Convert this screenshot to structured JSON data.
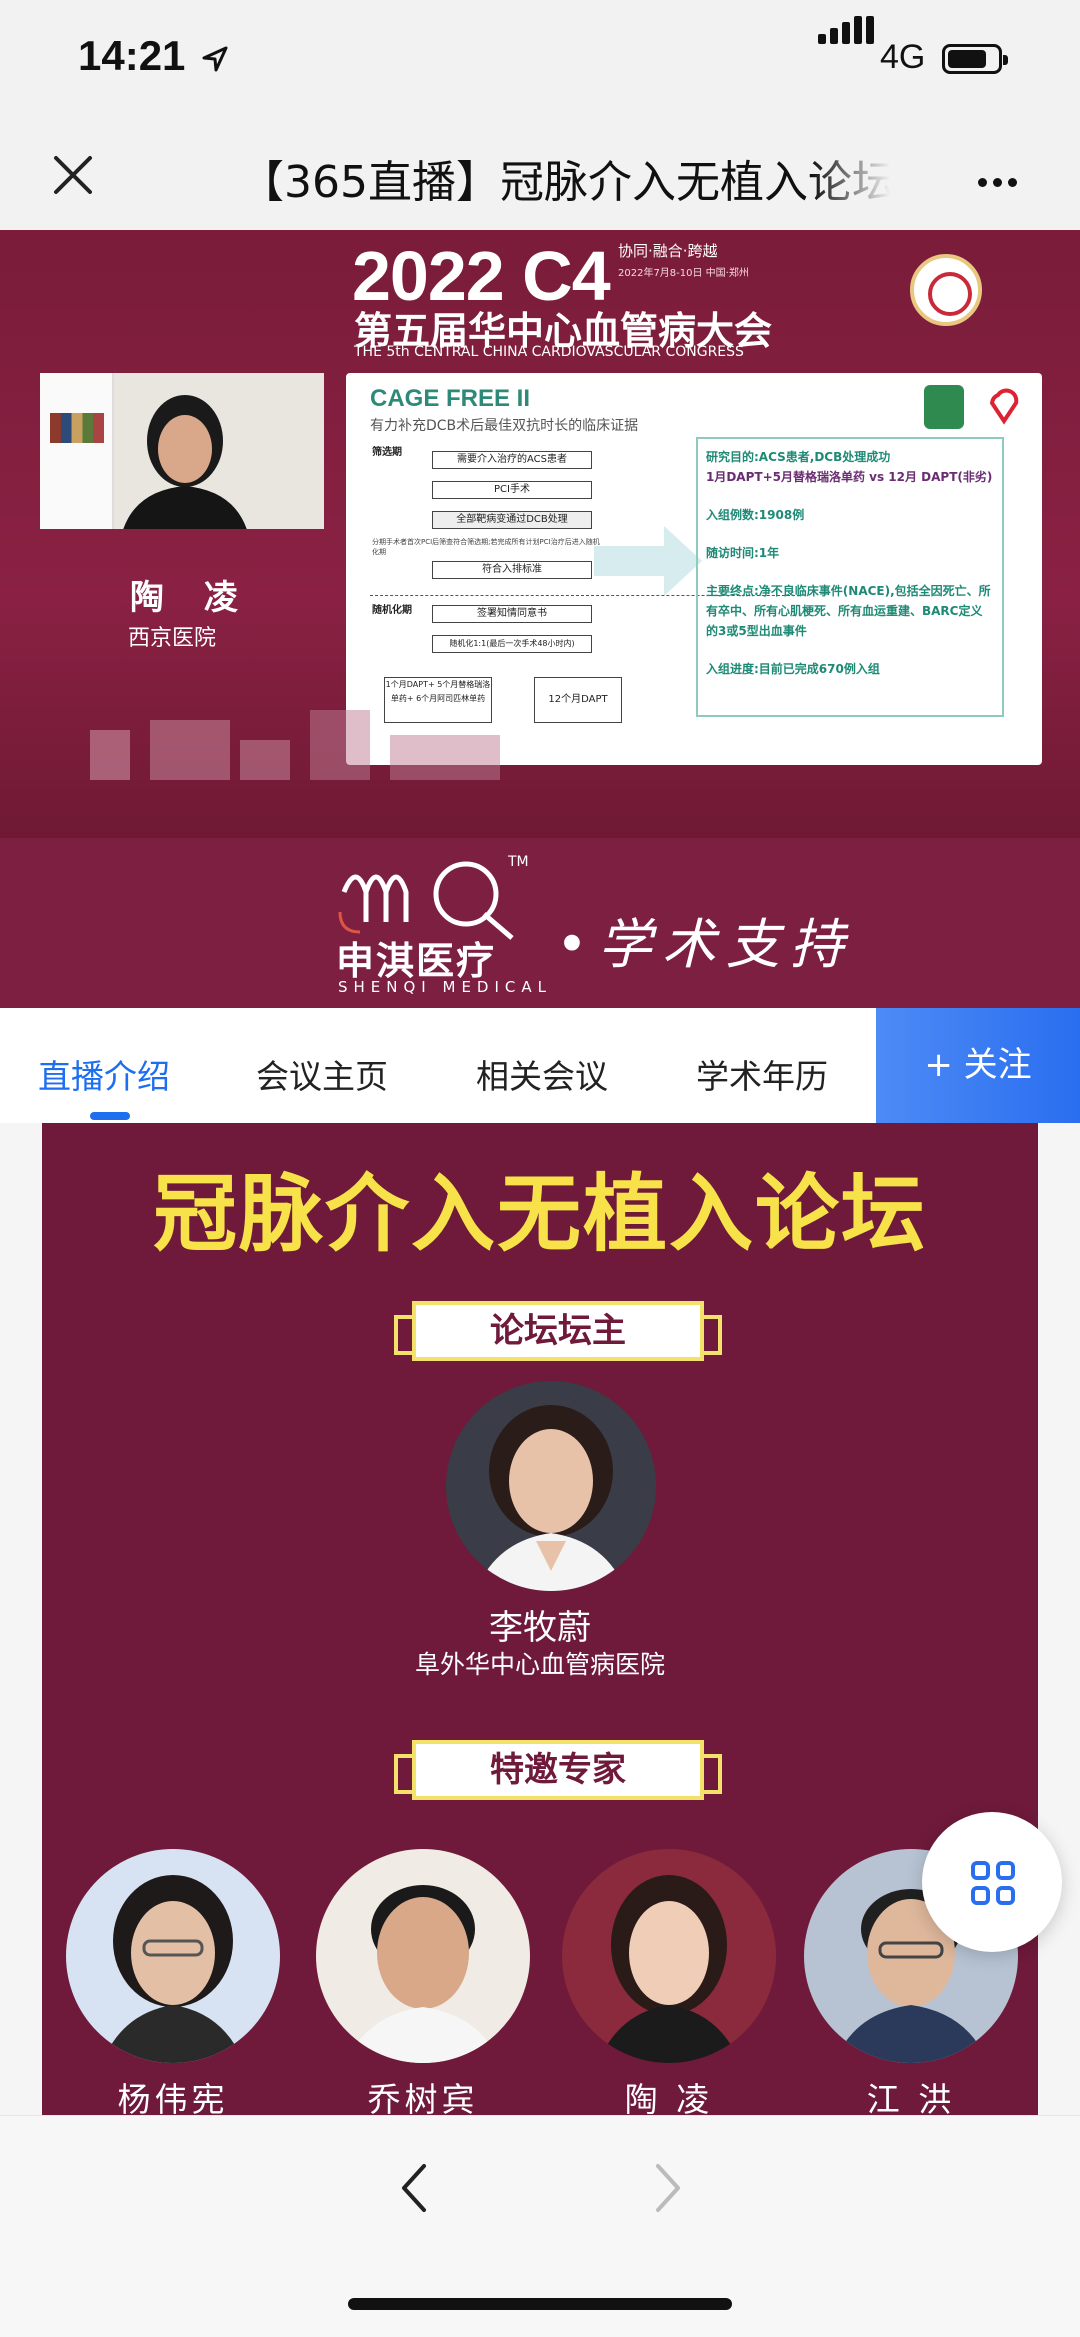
{
  "status": {
    "time": "14:21",
    "network": "4G",
    "battery_level": 0.8
  },
  "nav": {
    "title": "【365直播】冠脉介入无植入论坛"
  },
  "video": {
    "congress_year": "2022 C4",
    "motto": "协同·融合·跨越",
    "motto_dates": "2022年7月8-10日 中国·郑州",
    "congress_name": "第五届华中心血管病大会",
    "congress_en": "THE 5th CENTRAL CHINA CARDIOVASCULAR CONGRESS",
    "speaker": {
      "name": "陶 凌",
      "org": "西京医院"
    },
    "slide": {
      "title": "CAGE FREE II",
      "subtitle": "有力补充DCB术后最佳双抗时长的临床证据",
      "stage_screen": "筛选期",
      "stage_random": "随机化期",
      "flow": [
        "需要介入治疗的ACS患者",
        "PCI手术",
        "全部靶病变通过DCB处理",
        "符合入排标准",
        "签署知情同意书",
        "随机化1:1(最后一次手术48小时内)"
      ],
      "note": "分期手术者首次PCI后筛查符合筛选期;若完成所有计划PCI治疗后进入随机化期",
      "arm_a": "1个月DAPT+ 5个月替格瑞洛单药+ 6个月阿司匹林单药",
      "arm_b": "12个月DAPT",
      "info": {
        "purpose": "研究目的:ACS患者,DCB处理成功",
        "compare": "1月DAPT+5月替格瑞洛单药 vs 12月 DAPT(非劣)",
        "cases": "入组例数:1908例",
        "followup": "随访时间:1年",
        "endpoint": "主要终点:净不良临床事件(NACE),包括全因死亡、所有卒中、所有心肌梗死、所有血运重建、BARC定义的3或5型出血事件",
        "progress": "入组进度:目前已完成670例入组"
      }
    }
  },
  "sponsor": {
    "brand_cn": "申淇医疗",
    "brand_en": "SHENQI MEDICAL",
    "tm": "TM",
    "support": "•学术支持"
  },
  "tabs": [
    {
      "label": "直播介绍",
      "active": true
    },
    {
      "label": "会议主页",
      "active": false
    },
    {
      "label": "相关会议",
      "active": false
    },
    {
      "label": "学术年历",
      "active": false
    }
  ],
  "follow_button": "+ 关注",
  "poster": {
    "title": "冠脉介入无植入论坛",
    "host_badge": "论坛坛主",
    "host": {
      "name": "李牧蔚",
      "org": "阜外华中心血管病医院"
    },
    "experts_badge": "特邀专家",
    "experts": [
      {
        "name": "杨伟宪"
      },
      {
        "name": "乔树宾"
      },
      {
        "name": "陶 凌"
      },
      {
        "name": "江 洪"
      }
    ]
  },
  "colors": {
    "accent": "#1e6ef0",
    "poster_bg": "#6f1a3a",
    "title_yellow": "#f7e24a"
  }
}
